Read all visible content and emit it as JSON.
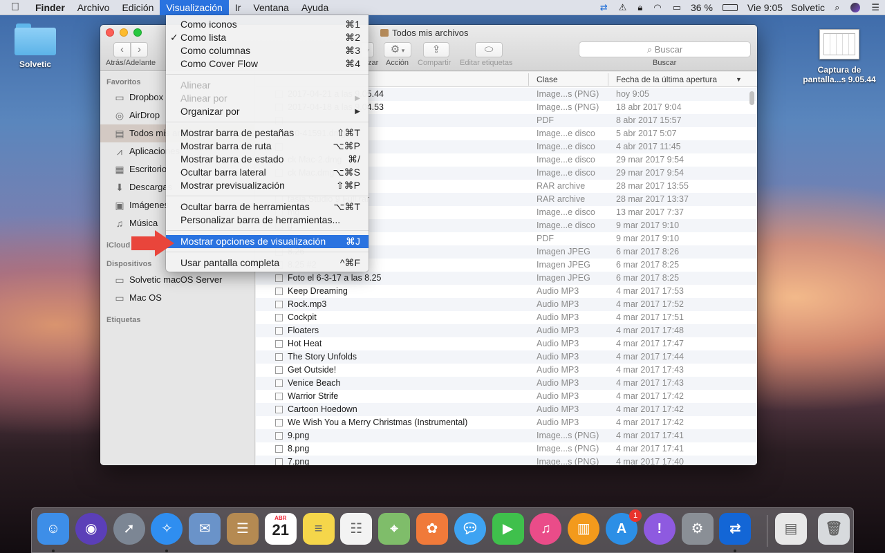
{
  "menubar": {
    "apple_icon": "apple-icon",
    "app_name": "Finder",
    "items": [
      "Archivo",
      "Edición",
      "Visualización",
      "Ir",
      "Ventana",
      "Ayuda"
    ],
    "active_item": "Visualización",
    "status": {
      "battery": "36 %",
      "clock": "Vie 9:05",
      "user": "Solvetic"
    },
    "status_icons": [
      "teamviewer-icon",
      "warning-icon",
      "lock-icon",
      "wifi-icon",
      "airplay-icon",
      "battery-icon",
      "search-icon",
      "siri-icon",
      "notifications-icon"
    ]
  },
  "desktop": {
    "items": [
      {
        "label": "Solvetic",
        "icon": "folder-icon"
      },
      {
        "label_line1": "Captura de",
        "label_line2": "pantalla...s 9.05.44",
        "icon": "screenshot-thumbnail-icon"
      }
    ]
  },
  "window": {
    "title": "Todos mis archivos",
    "toolbar": {
      "nav_label": "Atrás/Adelante",
      "back_icon": "chevron-left-icon",
      "forward_icon": "chevron-right-icon",
      "arrange_label": "zar",
      "action_label": "Acción",
      "share_label": "Compartir",
      "tags_label": "Editar etiquetas",
      "search_placeholder": "Buscar",
      "search_label": "Buscar"
    },
    "sidebar": {
      "favorites_header": "Favoritos",
      "favorites": [
        {
          "label": "Dropbox",
          "icon": "folder-icon"
        },
        {
          "label": "AirDrop",
          "icon": "airdrop-icon"
        },
        {
          "label": "Todos mis archivos",
          "icon": "all-files-icon",
          "selected": true
        },
        {
          "label": "Aplicaciones",
          "icon": "applications-icon"
        },
        {
          "label": "Escritorio",
          "icon": "desktop-icon"
        },
        {
          "label": "Descargas",
          "icon": "downloads-icon"
        },
        {
          "label": "Imágenes",
          "icon": "pictures-icon"
        },
        {
          "label": "Música",
          "icon": "music-icon"
        }
      ],
      "icloud_header": "iCloud",
      "devices_header": "Dispositivos",
      "devices": [
        {
          "label": "Solvetic macOS Server",
          "icon": "server-icon"
        },
        {
          "label": "Mac OS",
          "icon": "disk-icon"
        }
      ],
      "tags_header": "Etiquetas"
    },
    "list": {
      "columns": {
        "kind": "Clase",
        "date": "Fecha de la última apertura"
      },
      "rows": [
        {
          "name": "2017-04-21 a las 9.05.44",
          "kind": "Image...s (PNG)",
          "date": "hoy 9:05"
        },
        {
          "name": "2017-04-18 a las 9.04.53",
          "kind": "Image...s (PNG)",
          "date": "18 abr 2017 9:04"
        },
        {
          "name": "",
          "kind": "PDF",
          "date": "8 abr 2017 15:57"
        },
        {
          "name": "2.0-41591.dmg",
          "kind": "Image...e disco",
          "date": "5 abr 2017 5:07"
        },
        {
          "name": "",
          "kind": "Image...e disco",
          "date": "4 abr 2017 11:45"
        },
        {
          "name": "ck Mac-2.dmg",
          "kind": "Image...e disco",
          "date": "29 mar 2017 9:54"
        },
        {
          "name": "ck Mac.dmg",
          "kind": "Image...e disco",
          "date": "29 mar 2017 9:54"
        },
        {
          "name": "",
          "kind": "RAR archive",
          "date": "28 mar 2017 13:55"
        },
        {
          "name": "tasia Studio 9 Full.rar",
          "kind": "RAR archive",
          "date": "28 mar 2017 13:37"
        },
        {
          "name": "mg",
          "kind": "Image...e disco",
          "date": "13 mar 2017 7:37"
        },
        {
          "name": "g",
          "kind": "Image...e disco",
          "date": "9 mar 2017 9:10"
        },
        {
          "name": "box.pdf",
          "kind": "PDF",
          "date": "9 mar 2017 9:10"
        },
        {
          "name": "8.26",
          "kind": "Imagen JPEG",
          "date": "6 mar 2017 8:26"
        },
        {
          "name": "8.25 #2",
          "kind": "Imagen JPEG",
          "date": "6 mar 2017 8:25"
        },
        {
          "name": "Foto el 6-3-17 a las 8.25",
          "kind": "Imagen JPEG",
          "date": "6 mar 2017 8:25"
        },
        {
          "name": "Keep Dreaming",
          "kind": "Audio MP3",
          "date": "4 mar 2017 17:53"
        },
        {
          "name": "Rock.mp3",
          "kind": "Audio MP3",
          "date": "4 mar 2017 17:52"
        },
        {
          "name": "Cockpit",
          "kind": "Audio MP3",
          "date": "4 mar 2017 17:51"
        },
        {
          "name": "Floaters",
          "kind": "Audio MP3",
          "date": "4 mar 2017 17:48"
        },
        {
          "name": "Hot Heat",
          "kind": "Audio MP3",
          "date": "4 mar 2017 17:47"
        },
        {
          "name": "The Story Unfolds",
          "kind": "Audio MP3",
          "date": "4 mar 2017 17:44"
        },
        {
          "name": "Get Outside!",
          "kind": "Audio MP3",
          "date": "4 mar 2017 17:43"
        },
        {
          "name": "Venice Beach",
          "kind": "Audio MP3",
          "date": "4 mar 2017 17:43"
        },
        {
          "name": "Warrior Strife",
          "kind": "Audio MP3",
          "date": "4 mar 2017 17:42"
        },
        {
          "name": "Cartoon Hoedown",
          "kind": "Audio MP3",
          "date": "4 mar 2017 17:42"
        },
        {
          "name": "We Wish You a Merry Christmas (Instrumental)",
          "kind": "Audio MP3",
          "date": "4 mar 2017 17:42"
        },
        {
          "name": "9.png",
          "kind": "Image...s (PNG)",
          "date": "4 mar 2017 17:41"
        },
        {
          "name": "8.png",
          "kind": "Image...s (PNG)",
          "date": "4 mar 2017 17:41"
        },
        {
          "name": "7.png",
          "kind": "Image...s (PNG)",
          "date": "4 mar 2017 17:40"
        }
      ]
    }
  },
  "view_menu": {
    "items": [
      {
        "label": "Como iconos",
        "shortcut": "⌘1"
      },
      {
        "label": "Como lista",
        "shortcut": "⌘2",
        "checked": true,
        "check": "✓"
      },
      {
        "label": "Como columnas",
        "shortcut": "⌘3"
      },
      {
        "label": "Como Cover Flow",
        "shortcut": "⌘4"
      },
      {
        "label": "Alinear",
        "disabled": true
      },
      {
        "label": "Alinear por",
        "disabled": true,
        "submenu": true
      },
      {
        "label": "Organizar por",
        "submenu": true
      },
      {
        "label": "Mostrar barra de pestañas",
        "shortcut": "⇧⌘T"
      },
      {
        "label": "Mostrar barra de ruta",
        "shortcut": "⌥⌘P"
      },
      {
        "label": "Mostrar barra de estado",
        "shortcut": "⌘/"
      },
      {
        "label": "Ocultar barra lateral",
        "shortcut": "⌥⌘S"
      },
      {
        "label": "Mostrar previsualización",
        "shortcut": "⇧⌘P"
      },
      {
        "label": "Ocultar barra de herramientas",
        "shortcut": "⌥⌘T"
      },
      {
        "label": "Personalizar barra de herramientas..."
      },
      {
        "label": "Mostrar opciones de visualización",
        "shortcut": "⌘J",
        "highlighted": true
      },
      {
        "label": "Usar pantalla completa",
        "shortcut": "^⌘F"
      }
    ]
  },
  "dock": {
    "apps": [
      {
        "icon": "finder-icon",
        "color": "#3d8ee8",
        "running": true
      },
      {
        "icon": "siri-icon",
        "color": "#5b3fb8"
      },
      {
        "icon": "launchpad-icon",
        "color": "#7c8694"
      },
      {
        "icon": "safari-icon",
        "color": "#2f8ef0",
        "running": true
      },
      {
        "icon": "mail-icon",
        "color": "#6a93c9"
      },
      {
        "icon": "contacts-icon",
        "color": "#b58a52"
      },
      {
        "icon": "calendar-icon",
        "color": "#ffffff",
        "month": "ABR",
        "day": "21"
      },
      {
        "icon": "notes-icon",
        "color": "#f5d64a"
      },
      {
        "icon": "reminders-icon",
        "color": "#f3f3f3"
      },
      {
        "icon": "maps-icon",
        "color": "#7fbd6a"
      },
      {
        "icon": "photos-icon",
        "color": "#f07a3a"
      },
      {
        "icon": "messages-icon",
        "color": "#3ea3f2"
      },
      {
        "icon": "facetime-icon",
        "color": "#3fc04c"
      },
      {
        "icon": "itunes-icon",
        "color": "#ea4c89"
      },
      {
        "icon": "ibooks-icon",
        "color": "#f39a1c"
      },
      {
        "icon": "app-store-icon",
        "color": "#2c8fe6",
        "badge": "1"
      },
      {
        "icon": "feedback-icon",
        "color": "#8e5ae0"
      },
      {
        "icon": "system-preferences-icon",
        "color": "#8a8f96"
      },
      {
        "icon": "teamviewer-icon",
        "color": "#1366d6",
        "running": true
      }
    ],
    "extra": [
      {
        "icon": "downloads-stack-icon",
        "color": "#e8e8e8"
      },
      {
        "icon": "trash-icon",
        "color": "#d7dadd"
      }
    ]
  }
}
